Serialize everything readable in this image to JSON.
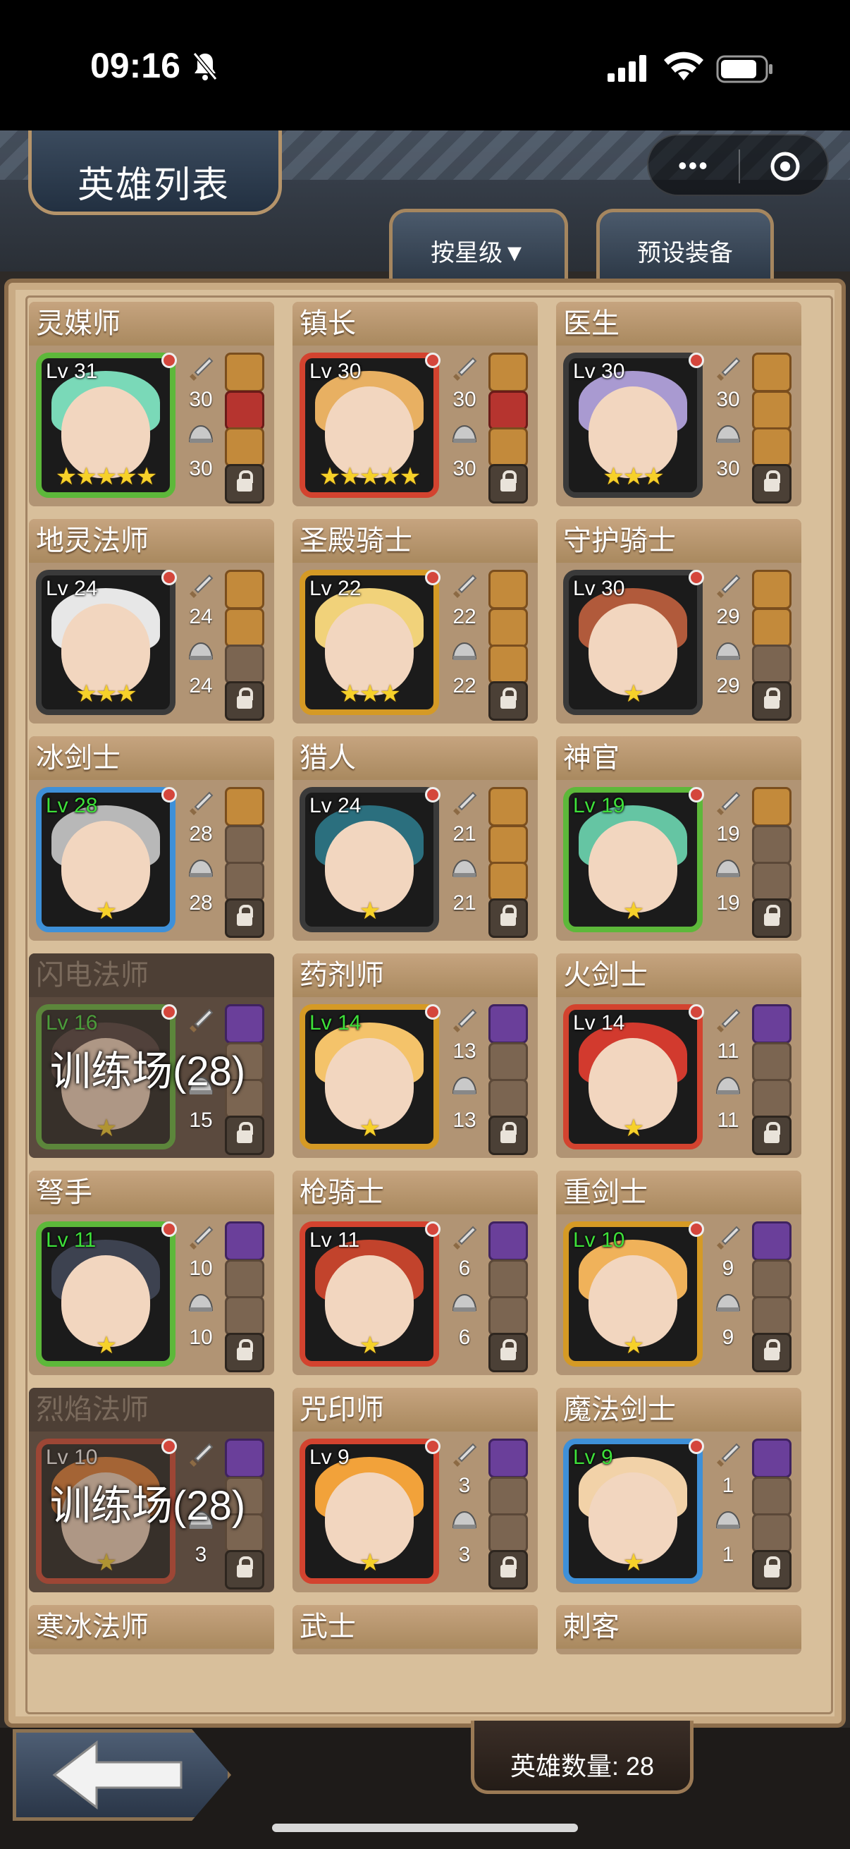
{
  "status": {
    "time": "09:16"
  },
  "header": {
    "title": "英雄列表",
    "sort_label": "按星级▼",
    "preset_label": "预设装备"
  },
  "footer": {
    "hero_count": "英雄数量: 28"
  },
  "colors": {
    "gold": "#f6d12a",
    "frame_green": "#5db83a",
    "frame_red": "#d3432f",
    "frame_blue": "#3e90d8",
    "frame_gold": "#d59a25",
    "frame_dark": "#3a3a3a"
  },
  "heroes": [
    {
      "name": "灵媒师",
      "level": "Lv 31",
      "weapon": "30",
      "armor": "30",
      "stars": "★★★★★",
      "frame": "green",
      "locked": false,
      "training": ""
    },
    {
      "name": "镇长",
      "level": "Lv 30",
      "weapon": "30",
      "armor": "30",
      "stars": "★★★★★",
      "frame": "red",
      "locked": false,
      "training": ""
    },
    {
      "name": "医生",
      "level": "Lv 30",
      "weapon": "30",
      "armor": "30",
      "stars": "★★★",
      "frame": "dark",
      "locked": false,
      "training": ""
    },
    {
      "name": "地灵法师",
      "level": "Lv 24",
      "weapon": "24",
      "armor": "24",
      "stars": "★★★",
      "frame": "dark",
      "locked": false,
      "training": ""
    },
    {
      "name": "圣殿骑士",
      "level": "Lv 22",
      "weapon": "22",
      "armor": "22",
      "stars": "★★★",
      "frame": "gold",
      "locked": false,
      "training": ""
    },
    {
      "name": "守护骑士",
      "level": "Lv 30",
      "weapon": "29",
      "armor": "29",
      "stars": "★",
      "frame": "dark",
      "locked": false,
      "training": ""
    },
    {
      "name": "冰剑士",
      "level": "Lv 28",
      "weapon": "28",
      "armor": "28",
      "stars": "★",
      "frame": "blue",
      "locked": false,
      "training": ""
    },
    {
      "name": "猎人",
      "level": "Lv 24",
      "weapon": "21",
      "armor": "21",
      "stars": "★",
      "frame": "dark",
      "locked": false,
      "training": ""
    },
    {
      "name": "神官",
      "level": "Lv 19",
      "weapon": "19",
      "armor": "19",
      "stars": "★",
      "frame": "green",
      "locked": false,
      "training": ""
    },
    {
      "name": "闪电法师",
      "level": "Lv 16",
      "weapon": "",
      "armor": "15",
      "stars": "★",
      "frame": "green",
      "locked": true,
      "training": "训练场(28)"
    },
    {
      "name": "药剂师",
      "level": "Lv 14",
      "weapon": "13",
      "armor": "13",
      "stars": "★",
      "frame": "gold",
      "locked": false,
      "training": ""
    },
    {
      "name": "火剑士",
      "level": "Lv 14",
      "weapon": "11",
      "armor": "11",
      "stars": "★",
      "frame": "red",
      "locked": false,
      "training": ""
    },
    {
      "name": "弩手",
      "level": "Lv 11",
      "weapon": "10",
      "armor": "10",
      "stars": "★",
      "frame": "green",
      "locked": false,
      "training": ""
    },
    {
      "name": "枪骑士",
      "level": "Lv 11",
      "weapon": "6",
      "armor": "6",
      "stars": "★",
      "frame": "red",
      "locked": false,
      "training": ""
    },
    {
      "name": "重剑士",
      "level": "Lv 10",
      "weapon": "9",
      "armor": "9",
      "stars": "★",
      "frame": "gold",
      "locked": false,
      "training": ""
    },
    {
      "name": "烈焰法师",
      "level": "Lv 10",
      "weapon": "",
      "armor": "3",
      "stars": "★",
      "frame": "red",
      "locked": true,
      "training": "训练场(28)"
    },
    {
      "name": "咒印师",
      "level": "Lv 9",
      "weapon": "3",
      "armor": "3",
      "stars": "★",
      "frame": "red",
      "locked": false,
      "training": ""
    },
    {
      "name": "魔法剑士",
      "level": "Lv 9",
      "weapon": "1",
      "armor": "1",
      "stars": "★",
      "frame": "blue",
      "locked": false,
      "training": ""
    }
  ],
  "partial_heroes": [
    {
      "name": "寒冰法师"
    },
    {
      "name": "武士"
    },
    {
      "name": "刺客"
    }
  ]
}
